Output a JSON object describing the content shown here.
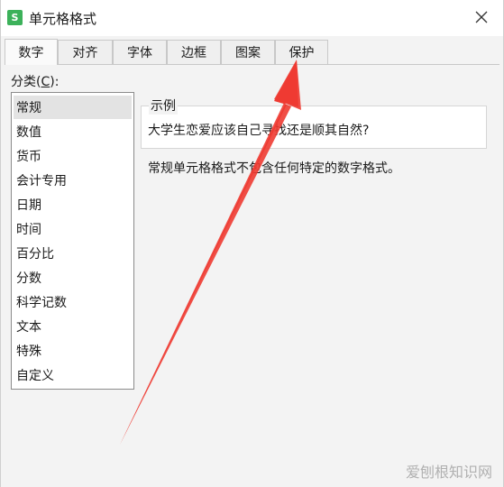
{
  "window": {
    "title": "单元格格式",
    "app_icon_label": "S"
  },
  "tabs": [
    {
      "label": "数字",
      "active": true
    },
    {
      "label": "对齐",
      "active": false
    },
    {
      "label": "字体",
      "active": false
    },
    {
      "label": "边框",
      "active": false
    },
    {
      "label": "图案",
      "active": false
    },
    {
      "label": "保护",
      "active": false
    }
  ],
  "category": {
    "label_prefix": "分类(",
    "label_hotkey": "C",
    "label_suffix": "):",
    "items": [
      "常规",
      "数值",
      "货币",
      "会计专用",
      "日期",
      "时间",
      "百分比",
      "分数",
      "科学记数",
      "文本",
      "特殊",
      "自定义"
    ],
    "selected": "常规"
  },
  "sample": {
    "legend": "示例",
    "text": "大学生恋爱应该自己寻找还是顺其自然?"
  },
  "description": "常规单元格格式不包含任何特定的数字格式。",
  "watermark": "爱刨根知识网",
  "colors": {
    "arrow": "#ee3b32",
    "app_icon": "#3cb15a"
  }
}
